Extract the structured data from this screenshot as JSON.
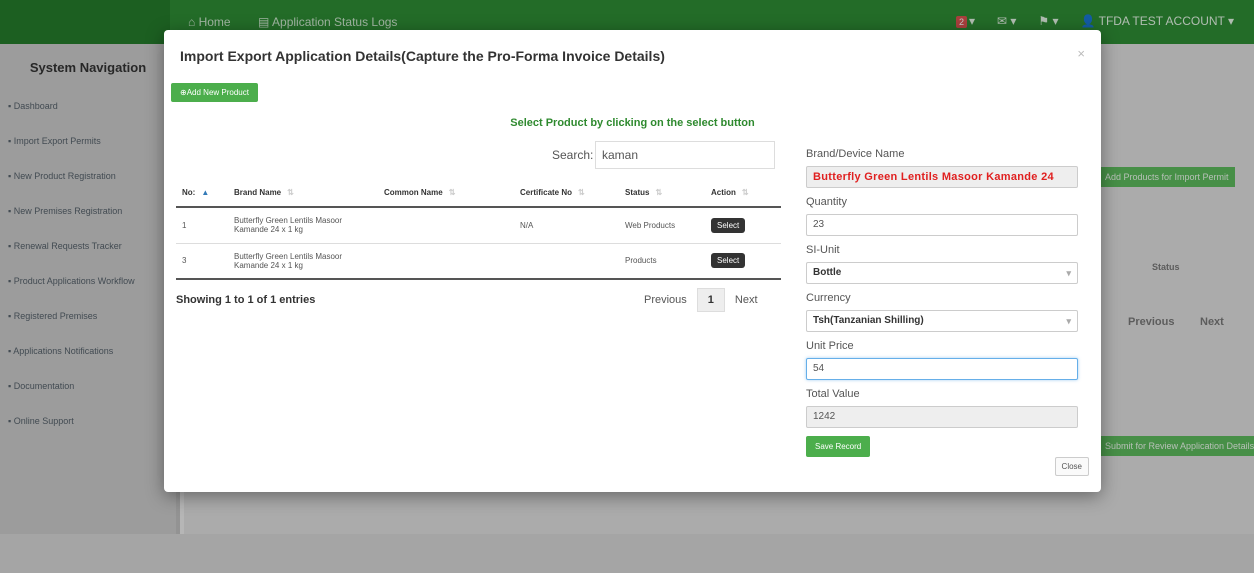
{
  "app": {
    "topbar": {
      "nav_home": "Home",
      "nav_status": "Application Status Logs",
      "alert_count": "2",
      "user": "TFDA TEST ACCOUNT"
    },
    "sidebar": {
      "title": "System Navigation",
      "items": [
        "Dashboard",
        "Import Export Permits",
        "New Product Registration",
        "New Premises Registration",
        "Renewal Requests Tracker",
        "Product Applications Workflow",
        "Registered Premises",
        "Applications Notifications",
        "Documentation",
        "Online Support"
      ]
    },
    "background": {
      "add_products_btn": "Add Products for Import Permit",
      "status_header": "Status",
      "previous": "Previous",
      "next": "Next",
      "submit_btn": "Submit for Review Application Details"
    }
  },
  "modal": {
    "title": "Import Export Application Details(Capture the Pro-Forma Invoice Details)",
    "close_x": "×",
    "add_new_product": "Add New Product",
    "select_hint": "Select Product by clicking on the select button",
    "search": {
      "label": "Search:",
      "value": "kaman"
    },
    "table": {
      "columns": [
        "No:",
        "Brand Name",
        "Common Name",
        "Certificate No",
        "Status",
        "Action"
      ],
      "rows": [
        {
          "no": "1",
          "brand_line1": "Butterfly Green Lentils Masoor",
          "brand_line2": "Kamande 24 x 1 kg",
          "common": "",
          "certificate": "N/A",
          "status": "Web Products",
          "action": "Select"
        },
        {
          "no": "3",
          "brand_line1": "Butterfly Green Lentils Masoor",
          "brand_line2": "Kamande 24 x 1 kg",
          "common": "",
          "certificate": "",
          "status": "Products",
          "action": "Select"
        }
      ]
    },
    "showing": "Showing 1 to 1 of 1 entries",
    "pagination": {
      "previous": "Previous",
      "current": "1",
      "next": "Next"
    },
    "form": {
      "brand_label": "Brand/Device Name",
      "brand_value": "Butterfly Green Lentils Masoor Kamande 24",
      "quantity_label": "Quantity",
      "quantity_value": "23",
      "si_unit_label": "SI-Unit",
      "si_unit_value": "Bottle",
      "currency_label": "Currency",
      "currency_value": "Tsh(Tanzanian Shilling)",
      "unit_price_label": "Unit Price",
      "unit_price_value": "54",
      "total_label": "Total Value",
      "total_value": "1242",
      "save_btn": "Save Record"
    },
    "close_btn": "Close"
  },
  "colors": {
    "topbar": "#2e8b34",
    "primary_green": "#4cae4c",
    "hint_green": "#2f8a2f",
    "brand_red": "#e02020",
    "focus_blue": "#66afe9"
  }
}
